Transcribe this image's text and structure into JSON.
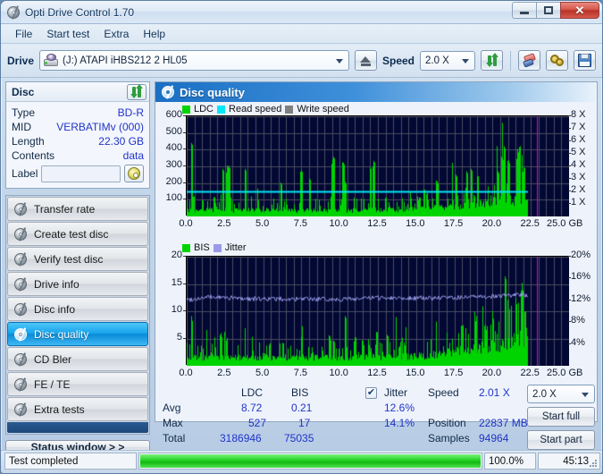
{
  "window": {
    "title": "Opti Drive Control 1.70",
    "icon": "disc-icon",
    "buttons": {
      "minimize": "minimize-icon",
      "maximize": "maximize-icon",
      "close": "close-icon"
    }
  },
  "menu": {
    "items": [
      "File",
      "Start test",
      "Extra",
      "Help"
    ]
  },
  "toolbar": {
    "drive_label": "Drive",
    "drive_value": "(J:)  ATAPI iHBS212  2 HL05",
    "eject_label": "eject-icon",
    "speed_label": "Speed",
    "speed_value": "2.0 X",
    "refresh_icon": "refresh-icon",
    "eraser_icon": "eraser-icon",
    "gear_icon": "gear-icon",
    "save_icon": "save-icon"
  },
  "disc": {
    "header": "Disc",
    "refresh_icon": "refresh-icon",
    "rows": [
      {
        "key": "Type",
        "value": "BD-R"
      },
      {
        "key": "MID",
        "value": "VERBATIMv (000)"
      },
      {
        "key": "Length",
        "value": "22.30 GB"
      },
      {
        "key": "Contents",
        "value": "data"
      }
    ],
    "label_key": "Label",
    "label_value": "",
    "label_button_icon": "cd-icon"
  },
  "sidebar": {
    "items": [
      {
        "label": "Transfer rate",
        "icon": "disc-icon",
        "active": false
      },
      {
        "label": "Create test disc",
        "icon": "disc-icon",
        "active": false
      },
      {
        "label": "Verify test disc",
        "icon": "disc-icon",
        "active": false
      },
      {
        "label": "Drive info",
        "icon": "disc-icon",
        "active": false
      },
      {
        "label": "Disc info",
        "icon": "disc-icon",
        "active": false
      },
      {
        "label": "Disc quality",
        "icon": "disc-icon",
        "active": true
      },
      {
        "label": "CD Bler",
        "icon": "disc-icon",
        "active": false
      },
      {
        "label": "FE / TE",
        "icon": "disc-icon",
        "active": false
      },
      {
        "label": "Extra tests",
        "icon": "disc-icon",
        "active": false
      }
    ],
    "status_window": "Status window > >"
  },
  "panel": {
    "title": "Disc quality",
    "icon": "disc-icon"
  },
  "stats": {
    "col_ldc": "LDC",
    "col_bis": "BIS",
    "jitter_label": "Jitter",
    "jitter_checked": true,
    "rows": [
      {
        "name": "Avg",
        "ldc": "8.72",
        "bis": "0.21",
        "jitter": "12.6%"
      },
      {
        "name": "Max",
        "ldc": "527",
        "bis": "17",
        "jitter": "14.1%"
      },
      {
        "name": "Total",
        "ldc": "3186946",
        "bis": "75035",
        "jitter": ""
      }
    ],
    "speed_key": "Speed",
    "speed_value": "2.01 X",
    "position_key": "Position",
    "position_value": "22837 MB",
    "samples_key": "Samples",
    "samples_value": "94964",
    "speed_combo_value": "2.0 X",
    "start_full": "Start full",
    "start_part": "Start part"
  },
  "statusbar": {
    "text": "Test completed",
    "percent_label": "100.0%",
    "percent_value": 100,
    "time": "45:13"
  },
  "colors": {
    "ldc_green": "#00d400",
    "read_speed_cyan": "#00e8f8",
    "write_speed_gray": "#808080",
    "bis_green": "#00d400",
    "jitter_purple": "#9a9ae8",
    "plot_bg": "#000833",
    "grid": "#4a4a5e",
    "marker_magenta": "#e000e0",
    "accent_blue": "#1a6fc4"
  },
  "chart_data": [
    {
      "type": "area",
      "id": "disc-quality-ldc",
      "title": "LDC / Read speed",
      "xlabel": "GB",
      "ylabel": "LDC",
      "xlim": [
        0,
        25.0
      ],
      "xticks": [
        0.0,
        2.5,
        5.0,
        7.5,
        10.0,
        12.5,
        15.0,
        17.5,
        20.0,
        22.5,
        25.0
      ],
      "xticklabels": [
        "0.0",
        "2.5",
        "5.0",
        "7.5",
        "10.0",
        "12.5",
        "15.0",
        "17.5",
        "20.0",
        "22.5",
        "25.0 GB"
      ],
      "ylim": [
        0,
        600
      ],
      "yticks": [
        100,
        200,
        300,
        400,
        500,
        600
      ],
      "yticklabels": [
        "100",
        "200",
        "300",
        "400",
        "500",
        "600"
      ],
      "y2lim": [
        0,
        8
      ],
      "y2ticks": [
        1,
        2,
        3,
        4,
        5,
        6,
        7,
        8
      ],
      "y2ticklabels": [
        "1 X",
        "2 X",
        "3 X",
        "4 X",
        "5 X",
        "6 X",
        "7 X",
        "8 X"
      ],
      "grid": true,
      "legend": [
        "LDC",
        "Read speed",
        "Write speed"
      ],
      "legend_position": "top-left",
      "data_end_x": 22.3,
      "marker_x": 22.9,
      "read_speed_constant": 2.01,
      "series": [
        {
          "name": "LDC",
          "color": "#00d400",
          "baseline": 40,
          "spikes": [
            [
              0.3,
              440
            ],
            [
              0.45,
              120
            ],
            [
              1.0,
              95
            ],
            [
              1.8,
              115
            ],
            [
              2.35,
              285
            ],
            [
              2.6,
              305
            ],
            [
              2.75,
              300
            ],
            [
              3.8,
              285
            ],
            [
              6.15,
              203
            ],
            [
              7.45,
              278
            ],
            [
              8.0,
              230
            ],
            [
              9.5,
              340
            ],
            [
              9.6,
              358
            ],
            [
              10.2,
              322
            ],
            [
              10.35,
              208
            ],
            [
              12.0,
              295
            ],
            [
              12.2,
              333
            ],
            [
              13.0,
              115
            ],
            [
              14.6,
              150
            ],
            [
              15.5,
              160
            ],
            [
              16.3,
              215
            ],
            [
              16.35,
              210
            ],
            [
              17.6,
              250
            ],
            [
              18.3,
              270
            ],
            [
              18.6,
              285
            ],
            [
              19.0,
              240
            ],
            [
              20.3,
              270
            ],
            [
              20.6,
              350
            ],
            [
              20.75,
              420
            ],
            [
              21.0,
              330
            ],
            [
              21.6,
              395
            ],
            [
              21.75,
              415
            ],
            [
              22.0,
              300
            ]
          ]
        },
        {
          "name": "Read speed",
          "color": "#00e8f8",
          "constant": 2.01,
          "axis": "y2"
        },
        {
          "name": "Write speed",
          "color": "#808080",
          "values": []
        }
      ]
    },
    {
      "type": "area",
      "id": "disc-quality-bis-jitter",
      "title": "BIS / Jitter",
      "xlabel": "GB",
      "ylabel": "BIS",
      "xlim": [
        0,
        25.0
      ],
      "xticks": [
        0.0,
        2.5,
        5.0,
        7.5,
        10.0,
        12.5,
        15.0,
        17.5,
        20.0,
        22.5,
        25.0
      ],
      "xticklabels": [
        "0.0",
        "2.5",
        "5.0",
        "7.5",
        "10.0",
        "12.5",
        "15.0",
        "17.5",
        "20.0",
        "22.5",
        "25.0 GB"
      ],
      "ylim": [
        0,
        20
      ],
      "yticks": [
        5,
        10,
        15,
        20
      ],
      "yticklabels": [
        "5",
        "10",
        "15",
        "20"
      ],
      "y2lim": [
        0,
        20
      ],
      "y2ticks": [
        4,
        8,
        12,
        16,
        20
      ],
      "y2ticklabels": [
        "4%",
        "8%",
        "12%",
        "16%",
        "20%"
      ],
      "grid": true,
      "legend": [
        "BIS",
        "Jitter"
      ],
      "legend_position": "top-left",
      "data_end_x": 22.3,
      "marker_x": 22.9,
      "series": [
        {
          "name": "BIS",
          "color": "#00d400",
          "baseline": 1.6,
          "spikes": [
            [
              0.3,
              9.1
            ],
            [
              0.35,
              4.3
            ],
            [
              1.05,
              3.1
            ],
            [
              1.6,
              2.4
            ],
            [
              2.2,
              6.0
            ],
            [
              2.45,
              6.2
            ],
            [
              2.6,
              5.1
            ],
            [
              3.8,
              6.9
            ],
            [
              5.1,
              2.3
            ],
            [
              6.3,
              4.1
            ],
            [
              7.5,
              5.3
            ],
            [
              8.2,
              2.7
            ],
            [
              9.3,
              5.6
            ],
            [
              9.6,
              4.6
            ],
            [
              10.35,
              9.1
            ],
            [
              11.0,
              5.2
            ],
            [
              11.5,
              4.6
            ],
            [
              12.4,
              6.2
            ],
            [
              13.1,
              5.6
            ],
            [
              14.2,
              4.3
            ],
            [
              16.3,
              8.1
            ],
            [
              17.0,
              6.1
            ],
            [
              18.0,
              7.3
            ],
            [
              18.9,
              9.0
            ],
            [
              19.5,
              7.6
            ],
            [
              20.0,
              10.0
            ],
            [
              20.8,
              16.4
            ],
            [
              21.2,
              11.0
            ],
            [
              21.5,
              12.5
            ],
            [
              21.9,
              15.2
            ],
            [
              22.1,
              10.0
            ]
          ]
        },
        {
          "name": "Jitter",
          "color": "#9a9ae8",
          "axis": "y2",
          "avg": 12.6,
          "max": 14.1,
          "trend": [
            [
              0.0,
              12.1
            ],
            [
              1.5,
              12.6
            ],
            [
              4.0,
              12.3
            ],
            [
              7.0,
              12.2
            ],
            [
              10.0,
              12.2
            ],
            [
              13.0,
              12.5
            ],
            [
              16.0,
              12.4
            ],
            [
              19.0,
              12.6
            ],
            [
              21.0,
              12.9
            ],
            [
              22.3,
              13.0
            ]
          ]
        }
      ]
    }
  ]
}
